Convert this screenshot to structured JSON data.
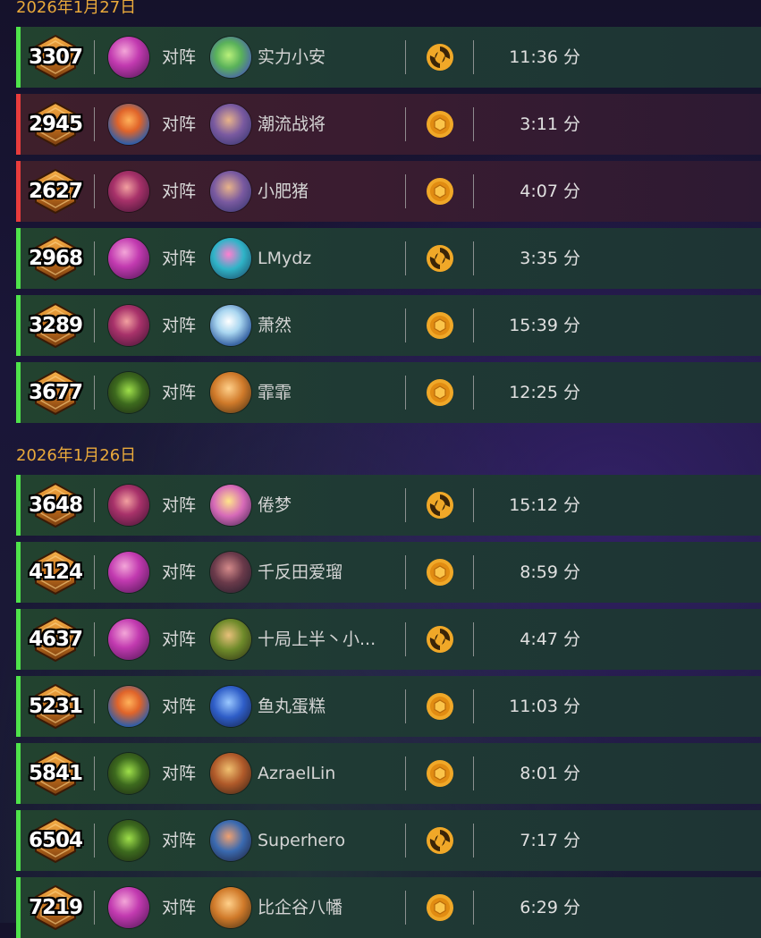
{
  "colors": {
    "win_bar": "#4fe34b",
    "loss_bar": "#e83c3c",
    "date_text": "#e9a93b",
    "mode_icon": "#f0a828"
  },
  "groups": [
    {
      "date": "2026年1月27日",
      "matches": [
        {
          "result": "win",
          "rating": "3307",
          "hero_icon": "pink-hero-icon",
          "vs": "对阵",
          "opponent_icon": "dragon-hero-icon",
          "opponent": "实力小安",
          "mode_icon": "swirl-mode-icon",
          "duration": "11:36 分"
        },
        {
          "result": "loss",
          "rating": "2945",
          "hero_icon": "fire-hero-icon",
          "vs": "对阵",
          "opponent_icon": "blue-hat-hero-icon",
          "opponent": "潮流战将",
          "mode_icon": "coin-mode-icon",
          "duration": "3:11 分"
        },
        {
          "result": "loss",
          "rating": "2627",
          "hero_icon": "purple-hero-icon",
          "vs": "对阵",
          "opponent_icon": "blue-hat-hero-icon",
          "opponent": "小肥猪",
          "mode_icon": "coin-mode-icon",
          "duration": "4:07 分"
        },
        {
          "result": "win",
          "rating": "2968",
          "hero_icon": "pink-hero-icon",
          "vs": "对阵",
          "opponent_icon": "teal-hero-icon",
          "opponent": "LMydz",
          "mode_icon": "swirl-mode-icon",
          "duration": "3:35 分"
        },
        {
          "result": "win",
          "rating": "3289",
          "hero_icon": "purple-hero-icon",
          "vs": "对阵",
          "opponent_icon": "ice-hero-icon",
          "opponent": "萧然",
          "mode_icon": "coin-mode-icon",
          "duration": "15:39 分"
        },
        {
          "result": "win",
          "rating": "3677",
          "hero_icon": "green-hero-icon",
          "vs": "对阵",
          "opponent_icon": "orange-hero-icon",
          "opponent": "霏霏",
          "mode_icon": "coin-mode-icon",
          "duration": "12:25 分"
        }
      ]
    },
    {
      "date": "2026年1月26日",
      "matches": [
        {
          "result": "win",
          "rating": "3648",
          "hero_icon": "purple-hero-icon",
          "vs": "对阵",
          "opponent_icon": "gold-hero-icon",
          "opponent": "倦梦",
          "mode_icon": "swirl-mode-icon",
          "duration": "15:12 分"
        },
        {
          "result": "win",
          "rating": "4124",
          "hero_icon": "pink-hero-icon",
          "vs": "对阵",
          "opponent_icon": "dark-hero-icon",
          "opponent": "千反田爱瑠",
          "mode_icon": "coin-mode-icon",
          "duration": "8:59 分"
        },
        {
          "result": "win",
          "rating": "4637",
          "hero_icon": "pink-hero-icon",
          "vs": "对阵",
          "opponent_icon": "goblin-hero-icon",
          "opponent": "十局上半丶小...",
          "mode_icon": "swirl-mode-icon",
          "duration": "4:47 分"
        },
        {
          "result": "win",
          "rating": "5231",
          "hero_icon": "fire-hero-icon",
          "vs": "对阵",
          "opponent_icon": "blue-dragon-hero-icon",
          "opponent": "鱼丸蛋糕",
          "mode_icon": "coin-mode-icon",
          "duration": "11:03 分"
        },
        {
          "result": "win",
          "rating": "5841",
          "hero_icon": "green-hero-icon",
          "vs": "对阵",
          "opponent_icon": "tauren-hero-icon",
          "opponent": "AzraelLin",
          "mode_icon": "coin-mode-icon",
          "duration": "8:01 分"
        },
        {
          "result": "win",
          "rating": "6504",
          "hero_icon": "green-hero-icon",
          "vs": "对阵",
          "opponent_icon": "pirate-hero-icon",
          "opponent": "Superhero",
          "mode_icon": "swirl-mode-icon",
          "duration": "7:17 分"
        },
        {
          "result": "win",
          "rating": "7219",
          "hero_icon": "pink-hero-icon",
          "vs": "对阵",
          "opponent_icon": "orange-hero-icon",
          "opponent": "比企谷八幡",
          "mode_icon": "coin-mode-icon",
          "duration": "6:29 分"
        }
      ]
    }
  ]
}
